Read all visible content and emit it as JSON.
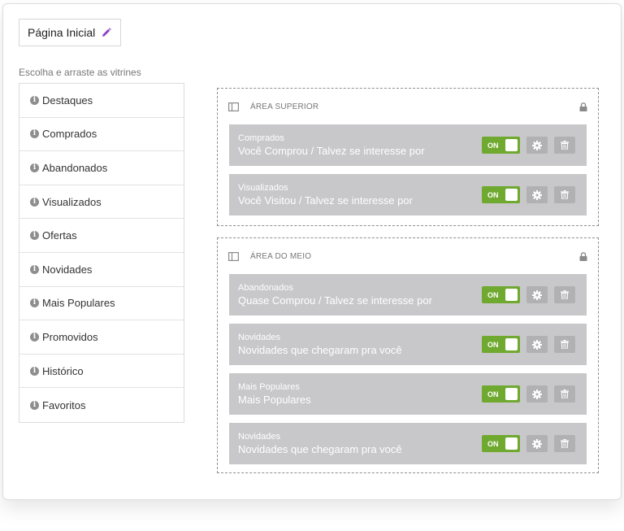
{
  "page": {
    "title": "Página Inicial",
    "hint": "Escolha e arraste as vitrines"
  },
  "vitrines": [
    {
      "label": "Destaques"
    },
    {
      "label": "Comprados"
    },
    {
      "label": "Abandonados"
    },
    {
      "label": "Visualizados"
    },
    {
      "label": "Ofertas"
    },
    {
      "label": "Novidades"
    },
    {
      "label": "Mais Populares"
    },
    {
      "label": "Promovidos"
    },
    {
      "label": "Histórico"
    },
    {
      "label": "Favoritos"
    }
  ],
  "areas": [
    {
      "title": "ÁREA SUPERIOR",
      "slots": [
        {
          "type": "Comprados",
          "title": "Você Comprou / Talvez se interesse por",
          "toggle": "ON"
        },
        {
          "type": "Visualizados",
          "title": "Você Visitou / Talvez se interesse por",
          "toggle": "ON"
        }
      ]
    },
    {
      "title": "ÁREA DO MEIO",
      "slots": [
        {
          "type": "Abandonados",
          "title": "Quase Comprou / Talvez se interesse por",
          "toggle": "ON"
        },
        {
          "type": "Novidades",
          "title": "Novidades que chegaram pra você",
          "toggle": "ON"
        },
        {
          "type": "Mais Populares",
          "title": "Mais Populares",
          "toggle": "ON"
        },
        {
          "type": "Novidades",
          "title": "Novidades que chegaram pra você",
          "toggle": "ON"
        }
      ]
    }
  ],
  "colors": {
    "toggle_on": "#6fa92f",
    "slot_bg": "#c8c7c9",
    "pencil": "#8e3fc4"
  },
  "icons": {
    "edit": "pencil-icon",
    "info": "info-icon",
    "layout": "layout-icon",
    "lock": "lock-icon",
    "settings": "gear-icon",
    "delete": "trash-icon"
  }
}
